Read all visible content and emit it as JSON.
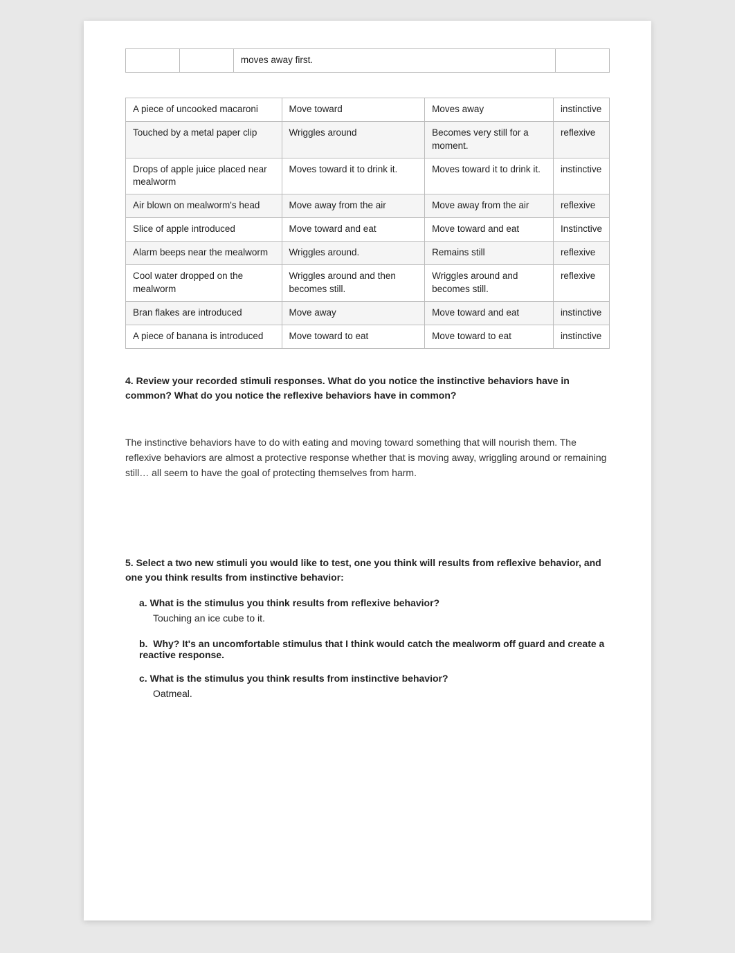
{
  "table": {
    "partial_row": {
      "col1": "",
      "col2": "",
      "col3": "moves away first.",
      "col4": ""
    },
    "rows": [
      {
        "stimulus": "A piece of uncooked macaroni",
        "predicted": "Move toward",
        "observed": "Moves away",
        "type": "instinctive"
      },
      {
        "stimulus": "Touched by a metal paper clip",
        "predicted": "Wriggles around",
        "observed": "Becomes very still for a moment.",
        "type": "reflexive"
      },
      {
        "stimulus": "Drops of apple juice placed near mealworm",
        "predicted": "Moves toward it to drink it.",
        "observed": "Moves toward it to drink it.",
        "type": "instinctive"
      },
      {
        "stimulus": "Air blown on mealworm's head",
        "predicted": "Move away from the air",
        "observed": "Move away from the air",
        "type": "reflexive"
      },
      {
        "stimulus": "Slice of apple introduced",
        "predicted": "Move toward and eat",
        "observed": "Move toward and eat",
        "type": "Instinctive"
      },
      {
        "stimulus": "Alarm beeps near the mealworm",
        "predicted": "Wriggles around.",
        "observed": "Remains still",
        "type": "reflexive"
      },
      {
        "stimulus": "Cool water dropped on the mealworm",
        "predicted": "Wriggles around and then becomes still.",
        "observed": "Wriggles around and becomes still.",
        "type": "reflexive"
      },
      {
        "stimulus": "Bran flakes are introduced",
        "predicted": "Move away",
        "observed": "Move toward and eat",
        "type": "instinctive"
      },
      {
        "stimulus": "A piece of banana is introduced",
        "predicted": "Move toward to eat",
        "observed": "Move toward to eat",
        "type": "instinctive"
      }
    ]
  },
  "q4": {
    "number": "4.",
    "label": "Review your recorded stimuli responses.  What do you notice the instinctive behaviors have in common?  What do you notice the reflexive behaviors have in common?",
    "answer": "The instinctive behaviors have to do with eating and moving toward something that will nourish them. The reflexive behaviors are almost a protective response whether that is moving away, wriggling around or remaining still… all seem to have the goal of protecting themselves from harm."
  },
  "q5": {
    "number": "5.",
    "label": "Select a two new stimuli you would like to test, one you think will results from reflexive behavior, and one you think results from instinctive behavior:",
    "sub_a_label": "a.   What is the stimulus you think results from reflexive behavior?",
    "sub_a_answer": "Touching an ice cube to it.",
    "sub_b_label": "b.   Why?",
    "sub_b_bold": "Why?",
    "sub_b_answer": " It's an uncomfortable stimulus that I think would catch the mealworm off guard and create a reactive response.",
    "sub_c_label": "c.   What is the stimulus you think results from instinctive behavior?",
    "sub_c_answer": "Oatmeal."
  }
}
